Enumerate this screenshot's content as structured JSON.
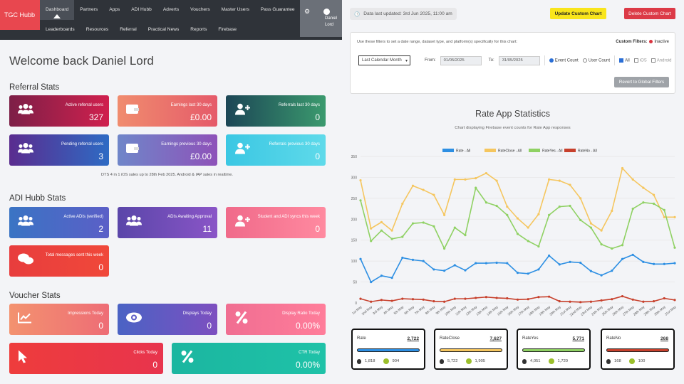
{
  "nav": {
    "logo": "TGC Hubb",
    "row1": [
      "Dashboard",
      "Partners",
      "Apps",
      "ADI Hubb",
      "Adverts",
      "Vouchers",
      "Master Users",
      "Pass Guarantee"
    ],
    "row2": [
      "Leaderboards",
      "Resources",
      "Referral",
      "Practical News",
      "Reports",
      "Firebase"
    ],
    "user_first": "Daniel",
    "user_last": "Lord"
  },
  "welcome": "Welcome back Daniel Lord",
  "referral": {
    "title": "Referral Stats",
    "cards": [
      {
        "label": "Active referral users",
        "value": "327",
        "icon": "users-icon",
        "colors": [
          "#7d1f47",
          "#d0204e"
        ]
      },
      {
        "label": "Earnings last 30 days",
        "value": "£0.00",
        "icon": "wallet-icon",
        "colors": [
          "#f08c6e",
          "#e55a6a"
        ]
      },
      {
        "label": "Referrals last 30 days",
        "value": "0",
        "icon": "user-plus-icon",
        "colors": [
          "#1c4656",
          "#3b9a6e"
        ]
      },
      {
        "label": "Pending referral users",
        "value": "3",
        "icon": "users-icon",
        "colors": [
          "#5a2c8f",
          "#2e6bc4"
        ]
      },
      {
        "label": "Earnings previous 30 days",
        "value": "£0.00",
        "icon": "wallet-icon",
        "colors": [
          "#6f86c9",
          "#8e52b9"
        ]
      },
      {
        "label": "Referrals previous 30 days",
        "value": "0",
        "icon": "user-plus-icon",
        "colors": [
          "#3bc7e3",
          "#5fdaea"
        ]
      }
    ],
    "note": "DTS 4 in 1 iOS sales up to 28th Feb 2025. Android & IAP sales in realtime."
  },
  "adi": {
    "title": "ADI Hubb Stats",
    "cards": [
      {
        "label": "Active ADIs (verified)",
        "value": "2",
        "icon": "users-icon",
        "colors": [
          "#3a74c4",
          "#5b5fc7"
        ]
      },
      {
        "label": "ADIs Awaiting Approval",
        "value": "11",
        "icon": "users-icon",
        "colors": [
          "#5a46a9",
          "#8a55c7"
        ]
      },
      {
        "label": "Student and ADI syncs this week",
        "value": "0",
        "icon": "user-plus-icon",
        "colors": [
          "#f06a8a",
          "#ff8aa0"
        ]
      },
      {
        "label": "Total messages sent this week",
        "value": "0",
        "icon": "chat-icon",
        "colors": [
          "#e83d3d",
          "#f0483a"
        ]
      }
    ]
  },
  "voucher": {
    "title": "Voucher Stats",
    "cards": [
      {
        "label": "Impressions Today",
        "value": "0",
        "icon": "chart-icon",
        "colors": [
          "#f3926f",
          "#ee6d76"
        ]
      },
      {
        "label": "Displays Today",
        "value": "0",
        "icon": "eye-icon",
        "colors": [
          "#4a63c4",
          "#7d4fc0"
        ]
      },
      {
        "label": "Display Ratio Today",
        "value": "0.00%",
        "icon": "percent-icon",
        "colors": [
          "#f06e92",
          "#ff7d9a"
        ]
      },
      {
        "label": "Clicks Today",
        "value": "0",
        "icon": "cursor-icon",
        "colors": [
          "#ee3c3c",
          "#e8344d"
        ]
      },
      {
        "label": "CTR Today",
        "value": "0.00%",
        "icon": "percent-icon",
        "colors": [
          "#1bb6a0",
          "#1fc2a8"
        ]
      }
    ]
  },
  "top": {
    "updated": "Data last updated: 3rd Jun 2025, 11:00 am",
    "update_btn": "Update Custom Chart",
    "delete_btn": "Delete Custom Chart"
  },
  "filters": {
    "hint": "Use these filters to set a date range, dataset type, and platform(s) specifically for this chart:",
    "custom_label": "Custom Filters:",
    "custom_status": "Inactive",
    "range": "Last Calendar Month",
    "from_label": "From:",
    "from": "01/05/2025",
    "to_label": "To:",
    "to": "31/05/2025",
    "event_count": "Event Count",
    "user_count": "User Count",
    "all": "All",
    "ios": "iOS",
    "android": "Android",
    "revert": "Revert to Global Filters"
  },
  "chart_title": "Rate App Statistics",
  "chart_subtitle": "Chart displaying Firebase event counts for Rate App responses",
  "chart_data": {
    "type": "line",
    "ylim": [
      0,
      350
    ],
    "yticks": [
      0,
      50,
      100,
      150,
      200,
      250,
      300,
      350
    ],
    "x": [
      "1st May",
      "2nd May",
      "3rd May",
      "4th May",
      "5th May",
      "6th May",
      "7th May",
      "8th May",
      "9th May",
      "10th May",
      "11th May",
      "12th May",
      "13th May",
      "14th May",
      "15th May",
      "16th May",
      "17th May",
      "18th May",
      "19th May",
      "20th May",
      "21st May",
      "22nd May",
      "23rd May",
      "24th May",
      "25th May",
      "26th May",
      "27th May",
      "28th May",
      "29th May",
      "30th May",
      "31st May"
    ],
    "series": [
      {
        "name": "Rate - All",
        "color": "#2d8fe3",
        "values": [
          105,
          50,
          65,
          60,
          108,
          103,
          100,
          80,
          77,
          90,
          78,
          95,
          95,
          96,
          95,
          72,
          70,
          80,
          113,
          92,
          98,
          96,
          76,
          66,
          77,
          105,
          115,
          98,
          93,
          93,
          95
        ]
      },
      {
        "name": "RateClose - All",
        "color": "#f5c65f",
        "values": [
          293,
          178,
          193,
          173,
          237,
          280,
          270,
          258,
          210,
          295,
          295,
          298,
          310,
          292,
          230,
          202,
          180,
          212,
          295,
          292,
          282,
          250,
          190,
          173,
          220,
          322,
          295,
          275,
          258,
          205,
          205
        ]
      },
      {
        "name": "RateYes - All",
        "color": "#8fd163",
        "values": [
          245,
          148,
          173,
          153,
          158,
          190,
          192,
          183,
          130,
          180,
          162,
          275,
          240,
          232,
          210,
          165,
          148,
          135,
          210,
          230,
          232,
          198,
          180,
          140,
          130,
          138,
          225,
          240,
          237,
          222,
          132
        ]
      },
      {
        "name": "RateNo - All",
        "color": "#c7402c",
        "values": [
          10,
          3,
          7,
          5,
          10,
          9,
          8,
          4,
          3,
          10,
          10,
          12,
          14,
          12,
          11,
          8,
          9,
          14,
          15,
          4,
          3,
          2,
          3,
          6,
          9,
          16,
          8,
          3,
          4,
          11,
          7
        ]
      }
    ]
  },
  "stat_cards": [
    {
      "name": "Rate",
      "total": "2,722",
      "ios": "1,818",
      "android": "904",
      "color": "#2d8fe3"
    },
    {
      "name": "RateClose",
      "total": "7,627",
      "ios": "5,722",
      "android": "1,905",
      "color": "#f5c65f"
    },
    {
      "name": "RateYes",
      "total": "5,771",
      "ios": "4,051",
      "android": "1,720",
      "color": "#8fd163"
    },
    {
      "name": "RateNo",
      "total": "268",
      "ios": "168",
      "android": "100",
      "color": "#c7402c"
    }
  ]
}
